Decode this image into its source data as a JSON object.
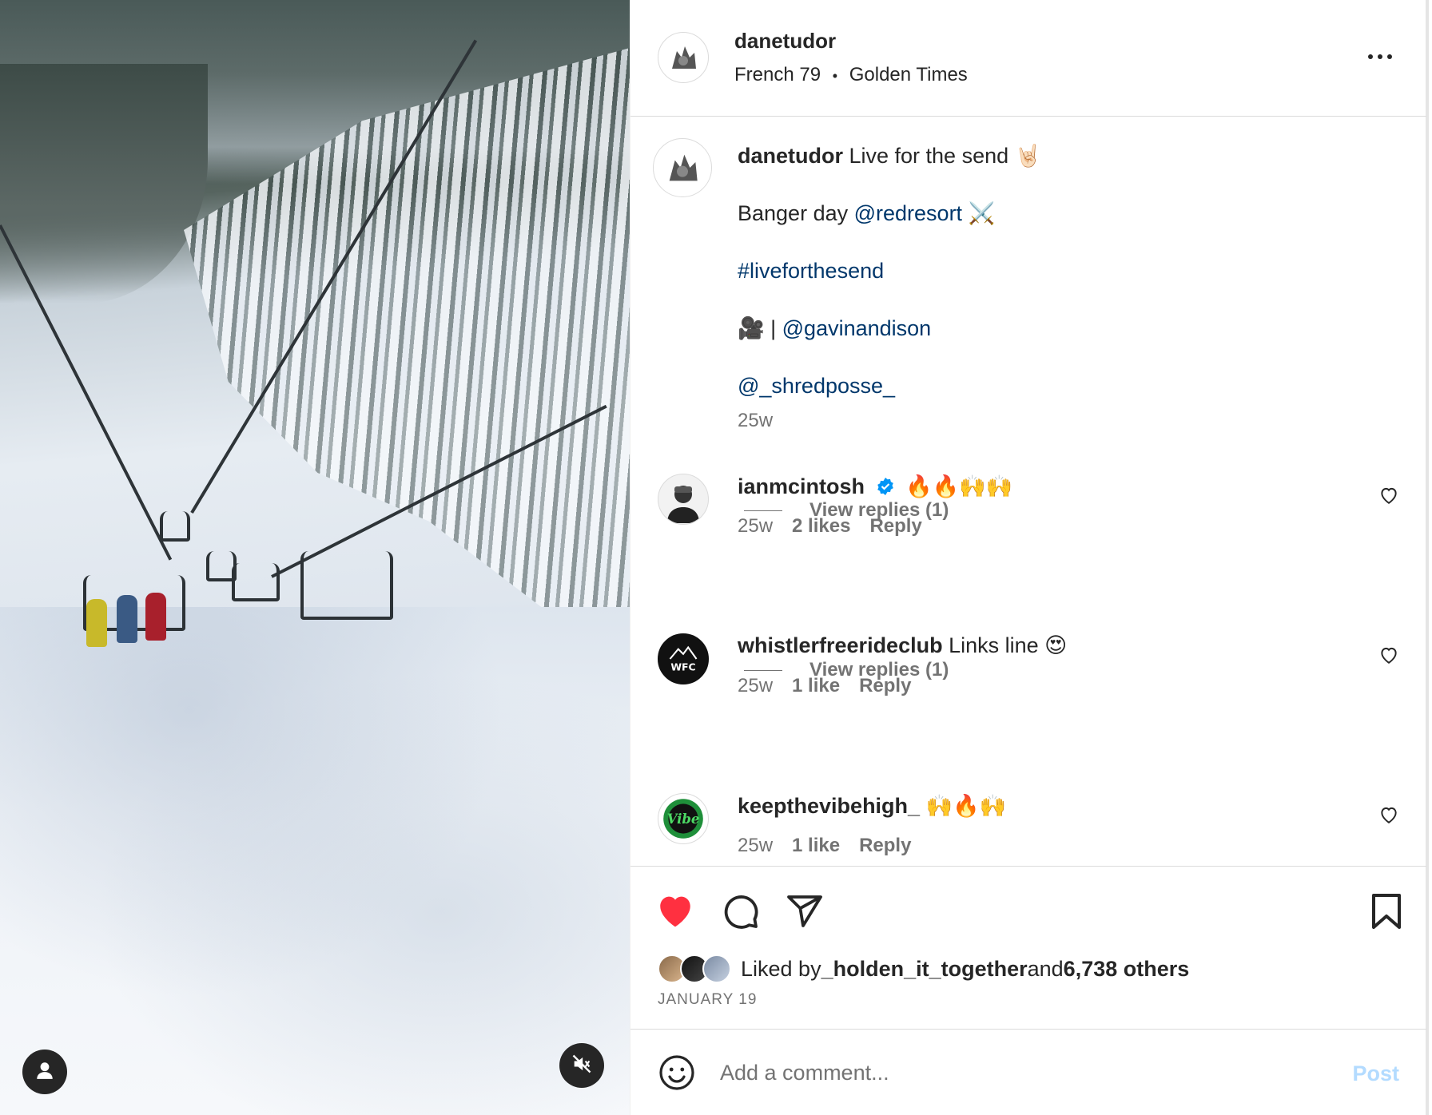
{
  "post": {
    "username": "danetudor",
    "audio_artist": "French 79",
    "audio_separator": "•",
    "audio_track": "Golden Times"
  },
  "caption": {
    "username": "danetudor",
    "line1_text": " Live for the send 🤘🏻",
    "line2_prefix": "Banger day ",
    "line2_mention": "@redresort",
    "line2_suffix": " ⚔️",
    "hashtag": "#liveforthesend",
    "line4_prefix": "🎥 | ",
    "line4_mention": "@gavinandison",
    "mention2": "@_shredposse_",
    "time": "25w"
  },
  "comments": [
    {
      "username": "ianmcintosh",
      "verified": true,
      "text": "🔥🔥🙌🙌",
      "time": "25w",
      "likes": "2 likes",
      "reply": "Reply",
      "view_replies": "View replies (1)"
    },
    {
      "username": "whistlerfreerideclub",
      "verified": false,
      "text": "Links line 😍",
      "time": "25w",
      "likes": "1 like",
      "reply": "Reply",
      "view_replies": "View replies (1)"
    },
    {
      "username": "keepthevibehigh_",
      "verified": false,
      "text": "🙌🔥🙌",
      "time": "25w",
      "likes": "1 like",
      "reply": "Reply"
    }
  ],
  "likes": {
    "prefix": "Liked by ",
    "user": "_holden_it_together",
    "middle": " and ",
    "others": "6,738 others"
  },
  "date": "JANUARY 19",
  "add_comment": {
    "placeholder": "Add a comment...",
    "post_label": "Post"
  },
  "colors": {
    "heart_liked": "#ff3040",
    "link": "#00376b",
    "secondary_text": "#737373",
    "post_disabled": "#b3dbff",
    "verified": "#0095f6"
  },
  "icons": [
    "more-icon",
    "heart-icon",
    "comment-icon",
    "share-icon",
    "bookmark-icon",
    "emoji-icon",
    "user-icon",
    "mute-icon",
    "verified-icon"
  ]
}
